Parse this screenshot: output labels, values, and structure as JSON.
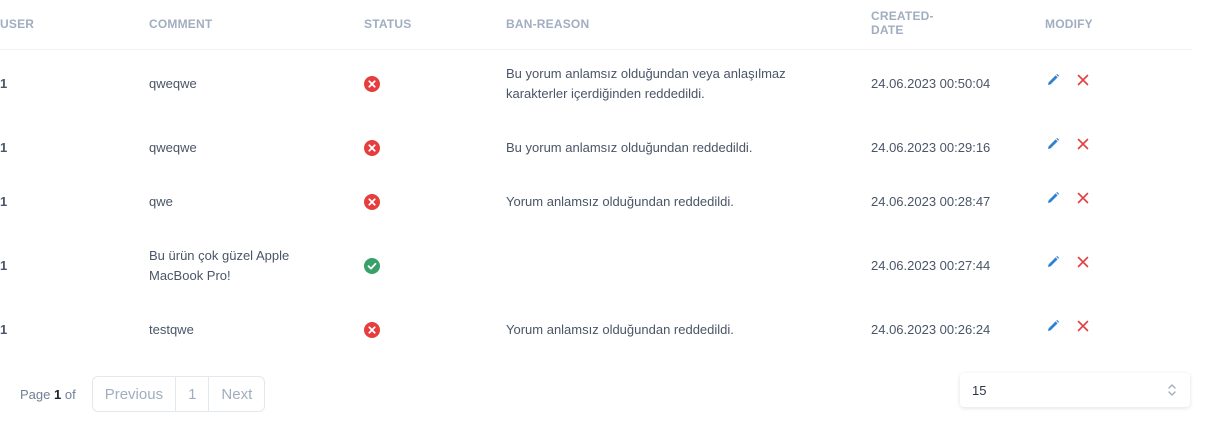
{
  "table": {
    "headers": {
      "user": "USER",
      "comment": "COMMENT",
      "status": "STATUS",
      "ban_reason": "BAN-REASON",
      "created_date_line1": "CREATED-",
      "created_date_line2": "DATE",
      "modify": "MODIFY"
    },
    "rows": [
      {
        "user": "1",
        "comment": "qweqwe",
        "status": "banned",
        "ban_reason": "Bu yorum anlamsız olduğundan veya anlaşılmaz karakterler içerdiğinden reddedildi.",
        "created_date": "24.06.2023 00:50:04"
      },
      {
        "user": "1",
        "comment": "qweqwe",
        "status": "banned",
        "ban_reason": "Bu yorum anlamsız olduğundan reddedildi.",
        "created_date": "24.06.2023 00:29:16"
      },
      {
        "user": "1",
        "comment": "qwe",
        "status": "banned",
        "ban_reason": "Yorum anlamsız olduğundan reddedildi.",
        "created_date": "24.06.2023 00:28:47"
      },
      {
        "user": "1",
        "comment": "Bu ürün çok güzel Apple MacBook Pro!",
        "status": "approved",
        "ban_reason": "",
        "created_date": "24.06.2023 00:27:44"
      },
      {
        "user": "1",
        "comment": "testqwe",
        "status": "banned",
        "ban_reason": "Yorum anlamsız olduğundan reddedildi.",
        "created_date": "24.06.2023 00:26:24"
      }
    ]
  },
  "pagination": {
    "page_prefix": "Page",
    "page_current": "1",
    "page_suffix": "of",
    "previous_label": "Previous",
    "page_number": "1",
    "next_label": "Next",
    "page_size": "15"
  },
  "colors": {
    "banned": "#e53e3e",
    "approved": "#38a169",
    "edit_icon": "#3182ce",
    "delete_icon": "#e53e3e"
  },
  "icons": {
    "banned": "x-circle-icon",
    "approved": "check-circle-icon",
    "edit": "pencil-icon",
    "delete": "close-icon",
    "select": "chevron-up-down-icon"
  }
}
